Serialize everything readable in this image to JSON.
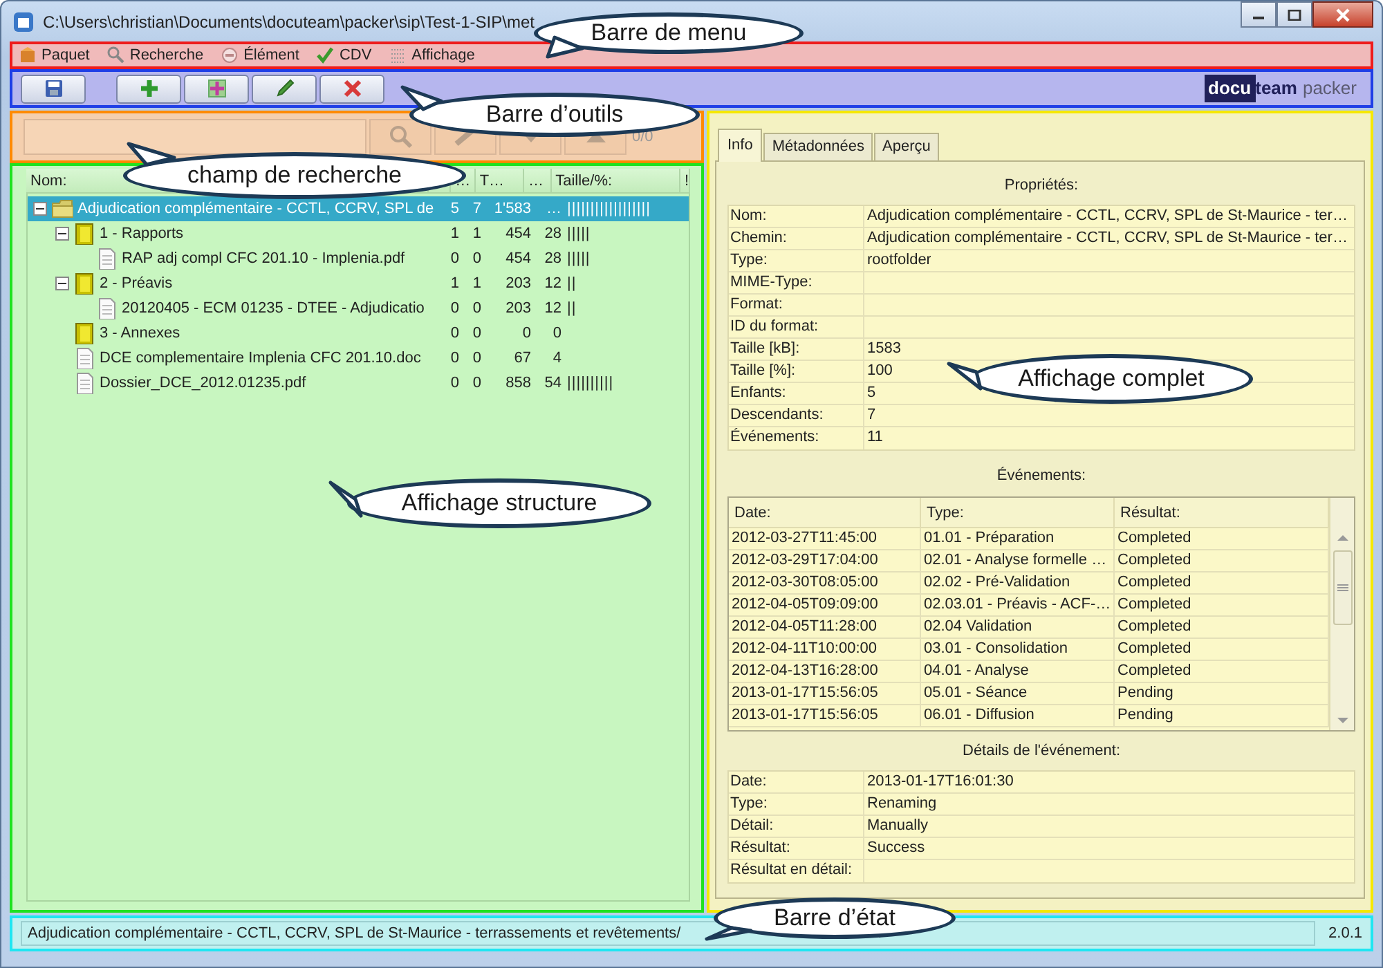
{
  "window": {
    "title": "C:\\Users\\christian\\Documents\\docuteam\\packer\\sip\\Test-1-SIP\\met"
  },
  "menu": [
    {
      "label": "Paquet"
    },
    {
      "label": "Recherche"
    },
    {
      "label": "Élément"
    },
    {
      "label": "CDV"
    },
    {
      "label": "Affichage"
    }
  ],
  "toolbar": {
    "logo": {
      "part_1": "docu",
      "part_2": "team",
      "part_3": "packer"
    }
  },
  "search": {
    "counter": "0/0",
    "buttons_disabled": true
  },
  "tree": {
    "header": {
      "column_1": "Nom:",
      "column_3": "…",
      "column_4": "T…",
      "column_5": "…",
      "column_6": "Taille/%:",
      "column_7": "!"
    },
    "items": [
      {
        "kind": "folder",
        "name": "Adjudication complémentaire - CCTL, CCRV, SPL de",
        "column_2": "5",
        "column_3": "7",
        "column_4": "1'583",
        "column_5": "…",
        "column_6": "||||||||||||||||||",
        "selected": true,
        "expanded": true,
        "children": [
          {
            "kind": "binder",
            "name": "1 - Rapports",
            "column_2": "1",
            "column_3": "1",
            "column_4": "454",
            "column_5": "28",
            "column_6": "|||||",
            "selected": false,
            "expanded": true,
            "children": [
              {
                "kind": "file",
                "name": "RAP adj compl CFC 201.10 - Implenia.pdf",
                "column_2": "0",
                "column_3": "0",
                "column_4": "454",
                "column_5": "28",
                "column_6": "|||||",
                "selected": false
              }
            ]
          },
          {
            "kind": "binder",
            "name": "2 - Préavis",
            "column_2": "1",
            "column_3": "1",
            "column_4": "203",
            "column_5": "12",
            "column_6": "||",
            "selected": false,
            "expanded": true,
            "children": [
              {
                "kind": "file",
                "name": "20120405 - ECM 01235 - DTEE - Adjudicatio",
                "column_2": "0",
                "column_3": "0",
                "column_4": "203",
                "column_5": "12",
                "column_6": "||",
                "selected": false
              }
            ]
          },
          {
            "kind": "binder",
            "name": "3 - Annexes",
            "column_2": "0",
            "column_3": "0",
            "column_4": "0",
            "column_5": "0",
            "selected": false
          },
          {
            "kind": "file",
            "name": "DCE complementaire Implenia CFC 201.10.doc",
            "column_2": "0",
            "column_3": "0",
            "column_4": "67",
            "column_5": "4",
            "selected": false
          },
          {
            "kind": "file",
            "name": "Dossier_DCE_2012.01235.pdf",
            "column_2": "0",
            "column_3": "0",
            "column_4": "858",
            "column_5": "54",
            "column_6": "||||||||||",
            "selected": false
          }
        ]
      }
    ]
  },
  "tabs": [
    {
      "label": "Info",
      "selected": true
    },
    {
      "label": "Métadonnées",
      "selected": false
    },
    {
      "label": "Aperçu",
      "selected": false
    }
  ],
  "properties": {
    "title": "Propriétés:",
    "rows": [
      {
        "label": "Nom:",
        "value": "Adjudication complémentaire - CCTL, CCRV, SPL de St-Maurice - ter…"
      },
      {
        "label": "Chemin:",
        "value": "Adjudication complémentaire - CCTL, CCRV, SPL de St-Maurice - ter…"
      },
      {
        "label": "Type:",
        "value": "rootfolder"
      },
      {
        "label": "MIME-Type:"
      },
      {
        "label": "Format:"
      },
      {
        "label": "ID du format:"
      },
      {
        "label": "Taille [kB]:",
        "value": "1583"
      },
      {
        "label": "Taille [%]:",
        "value": "100"
      },
      {
        "label": "Enfants:",
        "value": "5"
      },
      {
        "label": "Descendants:",
        "value": "7"
      },
      {
        "label": "Événements:",
        "value": "11"
      }
    ]
  },
  "events": {
    "title": "Événements:",
    "columns": [
      "Date:",
      "Type:",
      "Résultat:"
    ],
    "rows": [
      [
        "2012-03-27T11:45:00",
        "01.01 - Préparation",
        "Completed"
      ],
      [
        "2012-03-29T17:04:00",
        "02.01 - Analyse formelle …",
        "Completed"
      ],
      [
        "2012-03-30T08:05:00",
        "02.02 - Pré-Validation",
        "Completed"
      ],
      [
        "2012-04-05T09:09:00",
        "02.03.01 - Préavis - ACF-…",
        "Completed"
      ],
      [
        "2012-04-05T11:28:00",
        "02.04 Validation",
        "Completed"
      ],
      [
        "2012-04-11T10:00:00",
        "03.01 - Consolidation",
        "Completed"
      ],
      [
        "2012-04-13T16:28:00",
        "04.01 - Analyse",
        "Completed"
      ],
      [
        "2013-01-17T15:56:05",
        "05.01 - Séance",
        "Pending"
      ],
      [
        "2013-01-17T15:56:05",
        "06.01 - Diffusion",
        "Pending"
      ]
    ]
  },
  "event_details": {
    "title": "Détails de l'événement:",
    "rows": [
      {
        "label": "Date:",
        "value": "2013-01-17T16:01:30"
      },
      {
        "label": "Type:",
        "value": "Renaming"
      },
      {
        "label": "Détail:",
        "value": "Manually"
      },
      {
        "label": "Résultat:",
        "value": "Success"
      },
      {
        "label": "Résultat en détail:"
      }
    ]
  },
  "status_bar": {
    "path": "Adjudication complémentaire - CCTL, CCRV, SPL de St-Maurice - terrassements et revêtements/",
    "version": "2.0.1"
  },
  "callouts": [
    {
      "text": "Barre de menu"
    },
    {
      "text": "Barre d’outils"
    },
    {
      "text": "champ de recherche"
    },
    {
      "text": "Affichage complet"
    },
    {
      "text": "Affichage structure"
    },
    {
      "text": "Barre d’état"
    }
  ]
}
